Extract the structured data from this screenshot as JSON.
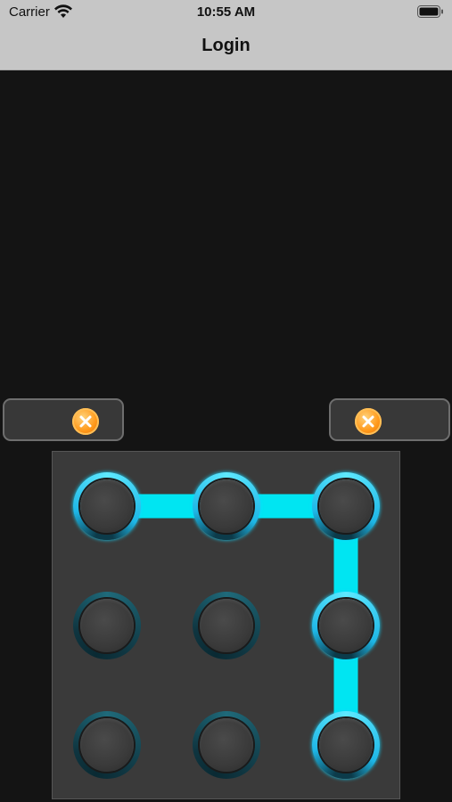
{
  "status_bar": {
    "carrier": "Carrier",
    "time": "10:55 AM"
  },
  "nav": {
    "title": "Login"
  },
  "pattern": {
    "rows": 3,
    "cols": 3,
    "selected_sequence": [
      0,
      1,
      2,
      5,
      8
    ],
    "line_color": "#00e5f2"
  },
  "colors": {
    "background": "#141414",
    "nav_bar": "#c6c6c6",
    "accent_cyan": "#00e5f2",
    "clear_button": "#ff9a1c"
  },
  "icons": {
    "left_clear": "close-circle-icon",
    "right_clear": "close-circle-icon"
  }
}
